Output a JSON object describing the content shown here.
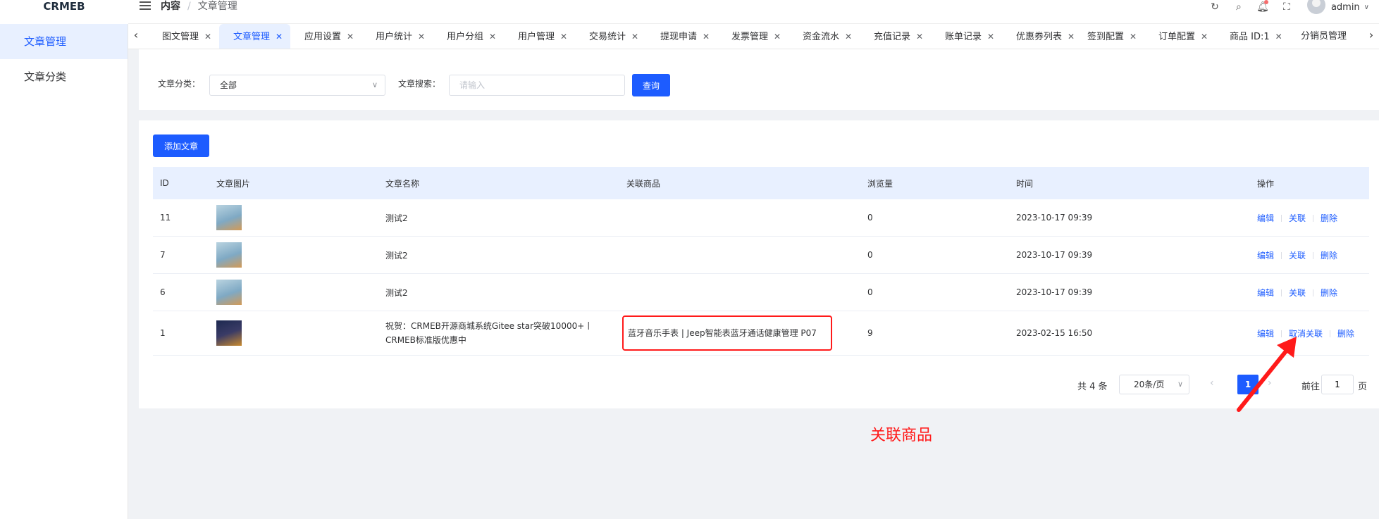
{
  "app": {
    "logo": "CRMEB"
  },
  "header": {
    "breadcrumb_root": "内容",
    "breadcrumb_sep": "/",
    "breadcrumb_current": "文章管理",
    "user_name": "admin"
  },
  "sidebar": {
    "items": [
      {
        "label": "文章管理",
        "active": true
      },
      {
        "label": "文章分类",
        "active": false
      }
    ]
  },
  "tabs": [
    {
      "label": "图文管理"
    },
    {
      "label": "文章管理",
      "active": true
    },
    {
      "label": "应用设置"
    },
    {
      "label": "用户统计"
    },
    {
      "label": "用户分组"
    },
    {
      "label": "用户管理"
    },
    {
      "label": "交易统计"
    },
    {
      "label": "提现申请"
    },
    {
      "label": "发票管理"
    },
    {
      "label": "资金流水"
    },
    {
      "label": "充值记录"
    },
    {
      "label": "账单记录"
    },
    {
      "label": "优惠券列表"
    },
    {
      "label": "签到配置"
    },
    {
      "label": "订单配置"
    },
    {
      "label": "商品 ID:1"
    },
    {
      "label": "分销员管理"
    }
  ],
  "filter": {
    "category_label": "文章分类：",
    "category_value": "全部",
    "search_label": "文章搜索：",
    "search_placeholder": "请输入",
    "search_value": "",
    "query_button": "查询"
  },
  "toolbar": {
    "add_button": "添加文章"
  },
  "table": {
    "headers": {
      "id": "ID",
      "image": "文章图片",
      "name": "文章名称",
      "product": "关联商品",
      "views": "浏览量",
      "time": "时间",
      "ops": "操作"
    },
    "rows": [
      {
        "id": "11",
        "name": "测试2",
        "product": "",
        "views": "0",
        "time": "2023-10-17 09:39",
        "ops": [
          "编辑",
          "关联",
          "删除"
        ]
      },
      {
        "id": "7",
        "name": "测试2",
        "product": "",
        "views": "0",
        "time": "2023-10-17 09:39",
        "ops": [
          "编辑",
          "关联",
          "删除"
        ]
      },
      {
        "id": "6",
        "name": "测试2",
        "product": "",
        "views": "0",
        "time": "2023-10-17 09:39",
        "ops": [
          "编辑",
          "关联",
          "删除"
        ]
      },
      {
        "id": "1",
        "name": "祝贺：CRMEB开源商城系统Gitee star突破10000+丨CRMEB标准版优惠中",
        "product": "蓝牙音乐手表 | Jeep智能表蓝牙通话健康管理 P07",
        "views": "9",
        "time": "2023-02-15 16:50",
        "ops": [
          "编辑",
          "取消关联",
          "删除"
        ]
      }
    ]
  },
  "pagination": {
    "total": "共 4 条",
    "page_size": "20条/页",
    "current_page": "1",
    "goto_label": "前往",
    "goto_value": "1",
    "goto_unit": "页"
  },
  "annotation": {
    "text": "关联商品",
    "color": "#ff1a1a"
  },
  "colors": {
    "primary": "#1d5cff",
    "active_bg": "#e8f0ff",
    "highlight": "#ff1a1a"
  }
}
